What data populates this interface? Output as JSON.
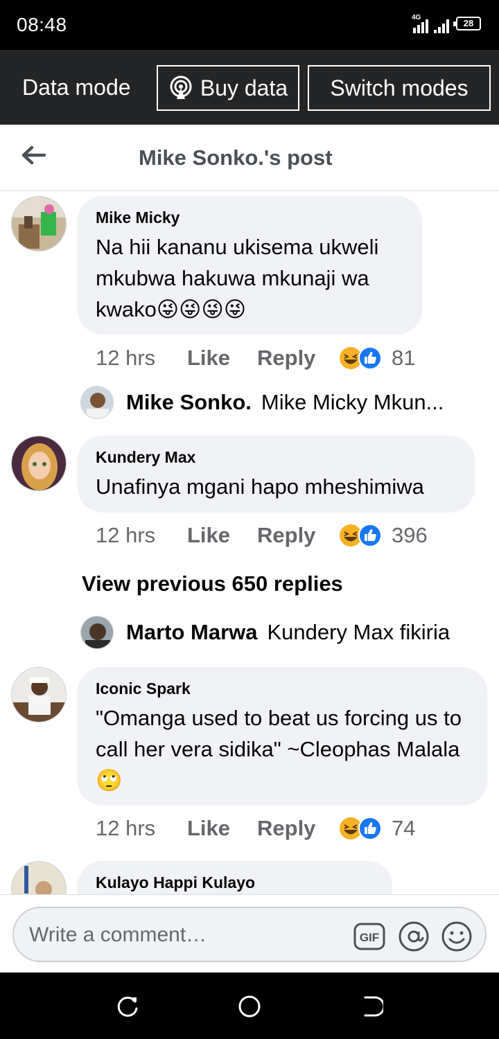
{
  "status": {
    "time": "08:48",
    "network": "4G",
    "battery": "28"
  },
  "data_bar": {
    "label": "Data mode",
    "buy_label": "Buy data",
    "switch_label": "Switch modes"
  },
  "header": {
    "title": "Mike Sonko.'s post"
  },
  "comments": [
    {
      "author": "Mike Micky",
      "text": "Na hii kananu ukisema ukweli mkubwa hakuwa mkunaji wa kwako😜😜😜😜",
      "time": "12 hrs",
      "like": "Like",
      "reply": "Reply",
      "reaction_count": "81",
      "reply_preview": {
        "name": "Mike Sonko.",
        "text": "Mike Micky Mkun..."
      }
    },
    {
      "author": "Kundery Max",
      "text": "Unafinya mgani hapo mheshimiwa",
      "time": "12 hrs",
      "like": "Like",
      "reply": "Reply",
      "reaction_count": "396",
      "view_previous": "View previous 650 replies",
      "reply_preview": {
        "name": "Marto Marwa",
        "text": "Kundery Max fikiria"
      }
    },
    {
      "author": "Iconic Spark",
      "text": "\"Omanga used to beat us forcing us to call her vera sidika\" ~Cleophas Malala🙄",
      "time": "12 hrs",
      "like": "Like",
      "reply": "Reply",
      "reaction_count": "74"
    },
    {
      "author": "Kulayo Happi Kulayo"
    }
  ],
  "composer": {
    "placeholder": "Write a comment…",
    "gif_label": "GIF"
  },
  "colors": {
    "facebook_blue": "#1877f2",
    "haha_yellow": "#f7b125",
    "bubble_bg": "#f0f2f5",
    "dark_bar": "#242526"
  }
}
